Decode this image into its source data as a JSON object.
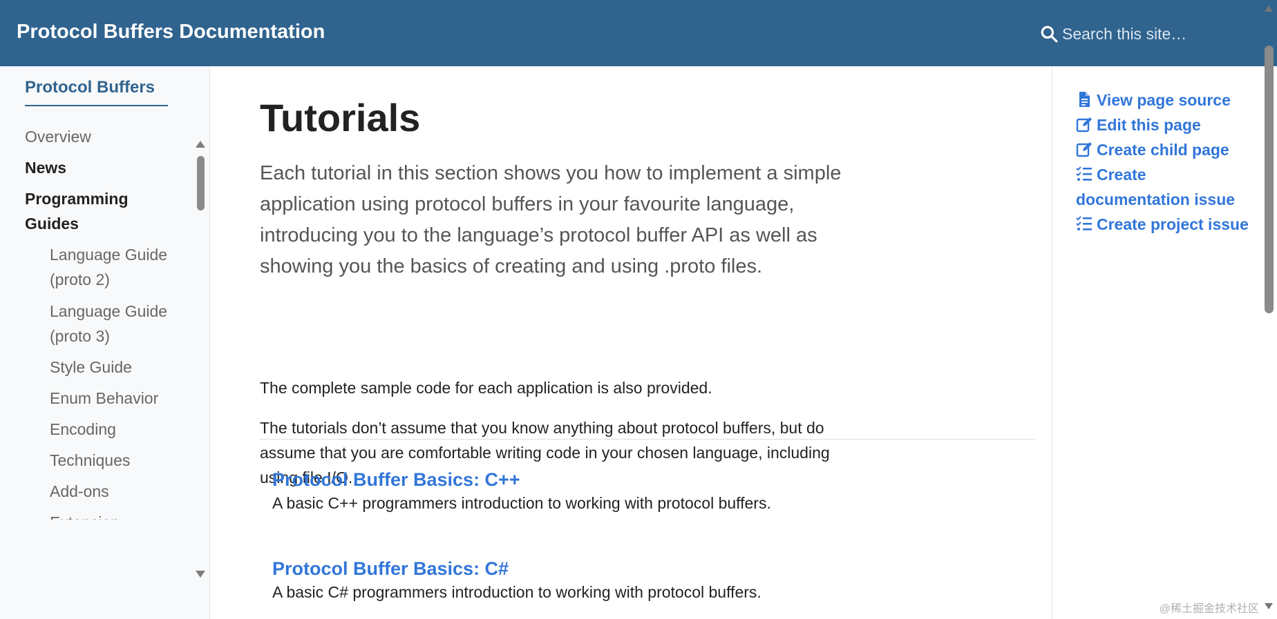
{
  "header": {
    "site_title": "Protocol Buffers Documentation",
    "search_placeholder": "Search this site…",
    "brand_color": "#30638e"
  },
  "sidebar": {
    "section_title": "Protocol Buffers",
    "items": [
      {
        "label": "Overview",
        "style": "light"
      },
      {
        "label": "News",
        "style": "bold"
      },
      {
        "label": "Programming",
        "style": "bold"
      },
      {
        "label": "Guides",
        "style": "bold"
      },
      {
        "label": "Language Guide",
        "style": "sub"
      },
      {
        "label": "(proto 2)",
        "style": "sub"
      },
      {
        "label": "Language Guide",
        "style": "sub"
      },
      {
        "label": "(proto 3)",
        "style": "sub"
      },
      {
        "label": "Style Guide",
        "style": "sub"
      },
      {
        "label": "Enum Behavior",
        "style": "sub"
      },
      {
        "label": "Encoding",
        "style": "sub"
      },
      {
        "label": "Techniques",
        "style": "sub"
      },
      {
        "label": "Add-ons",
        "style": "sub"
      },
      {
        "label": "Extension",
        "style": "sub"
      }
    ]
  },
  "main": {
    "title": "Tutorials",
    "lead": "Each tutorial in this section shows you how to implement a simple application using protocol buffers in your favourite language, introducing you to the language’s protocol buffer API as well as showing you the basics of creating and using .proto files.",
    "para1": "The complete sample code for each application is also provided.",
    "para2": "The tutorials don’t assume that you know anything about protocol buffers, but do assume that you are comfortable writing code in your chosen language, including using file I/O.",
    "entries": [
      {
        "title": "Protocol Buffer Basics: C++",
        "desc": "A basic C++ programmers introduction to working with protocol buffers."
      },
      {
        "title": "Protocol Buffer Basics: C#",
        "desc": "A basic C# programmers introduction to working with protocol buffers."
      }
    ]
  },
  "toc": {
    "links": [
      {
        "label": "View page source",
        "icon": "file-icon"
      },
      {
        "label": "Edit this page",
        "icon": "edit-icon"
      },
      {
        "label": "Create child page",
        "icon": "edit-icon"
      },
      {
        "label": "Create documentation issue",
        "icon": "tasks-icon"
      },
      {
        "label": "Create project issue",
        "icon": "tasks-icon"
      }
    ],
    "link_color": "#3176d9"
  },
  "watermark": "@稀土掘金技术社区"
}
